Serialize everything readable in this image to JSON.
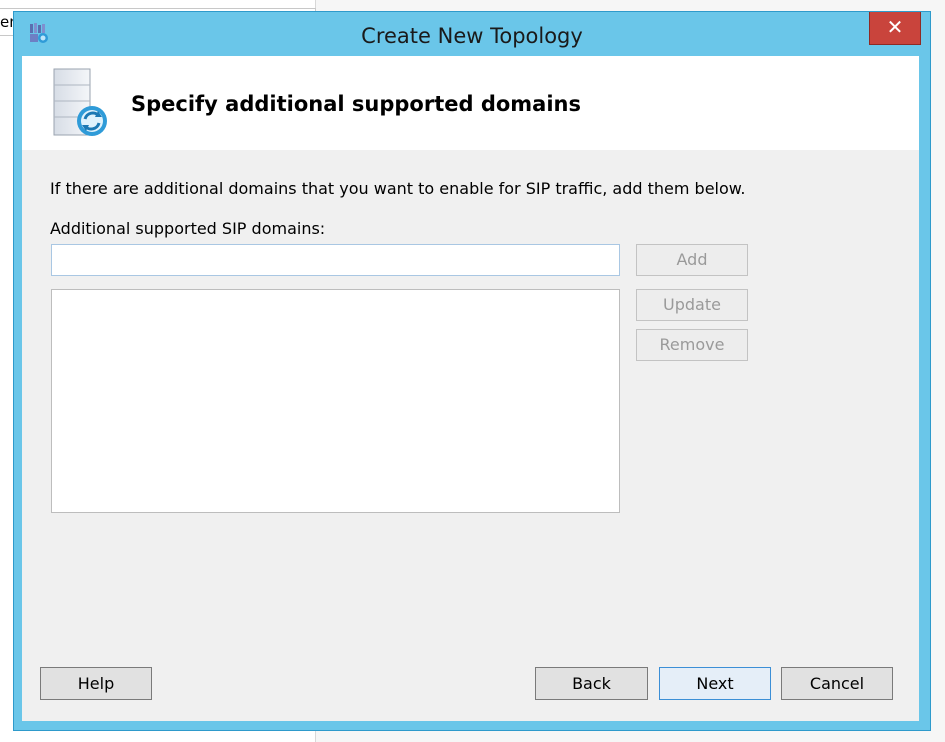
{
  "background": {
    "field_text": "en"
  },
  "window": {
    "title": "Create New Topology",
    "close_glyph": "✕",
    "app_icon": "topology-icon"
  },
  "header": {
    "icon": "server-refresh-icon",
    "title": "Specify additional supported domains"
  },
  "body": {
    "instruction": "If there are additional domains that you want to enable for SIP traffic, add them below.",
    "field_label": "Additional supported SIP domains:",
    "domain_input": {
      "value": "",
      "placeholder": ""
    },
    "domains": []
  },
  "side_buttons": {
    "add": "Add",
    "update": "Update",
    "remove": "Remove"
  },
  "footer": {
    "help": "Help",
    "back": "Back",
    "next": "Next",
    "cancel": "Cancel"
  },
  "colors": {
    "frame": "#6ac6e9",
    "close_button": "#c9443c",
    "client_bg": "#f0f0f0",
    "primary_border": "#3c8fd6"
  }
}
